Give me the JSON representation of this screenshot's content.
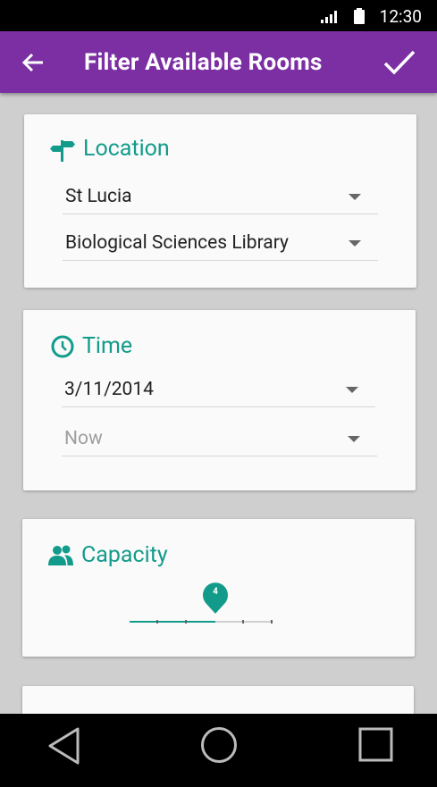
{
  "status_bar": {
    "time": "12:30"
  },
  "app_bar": {
    "title": "Filter Available Rooms"
  },
  "location": {
    "title": "Location",
    "campus": "St Lucia",
    "building": "Biological Sciences Library"
  },
  "time": {
    "title": "Time",
    "date": "3/11/2014",
    "time_value": "Now"
  },
  "capacity": {
    "title": "Capacity",
    "value": "4",
    "level_fraction": 0.6
  },
  "colors": {
    "accent": "#129b8b",
    "app_bar": "#7b2fa3"
  }
}
